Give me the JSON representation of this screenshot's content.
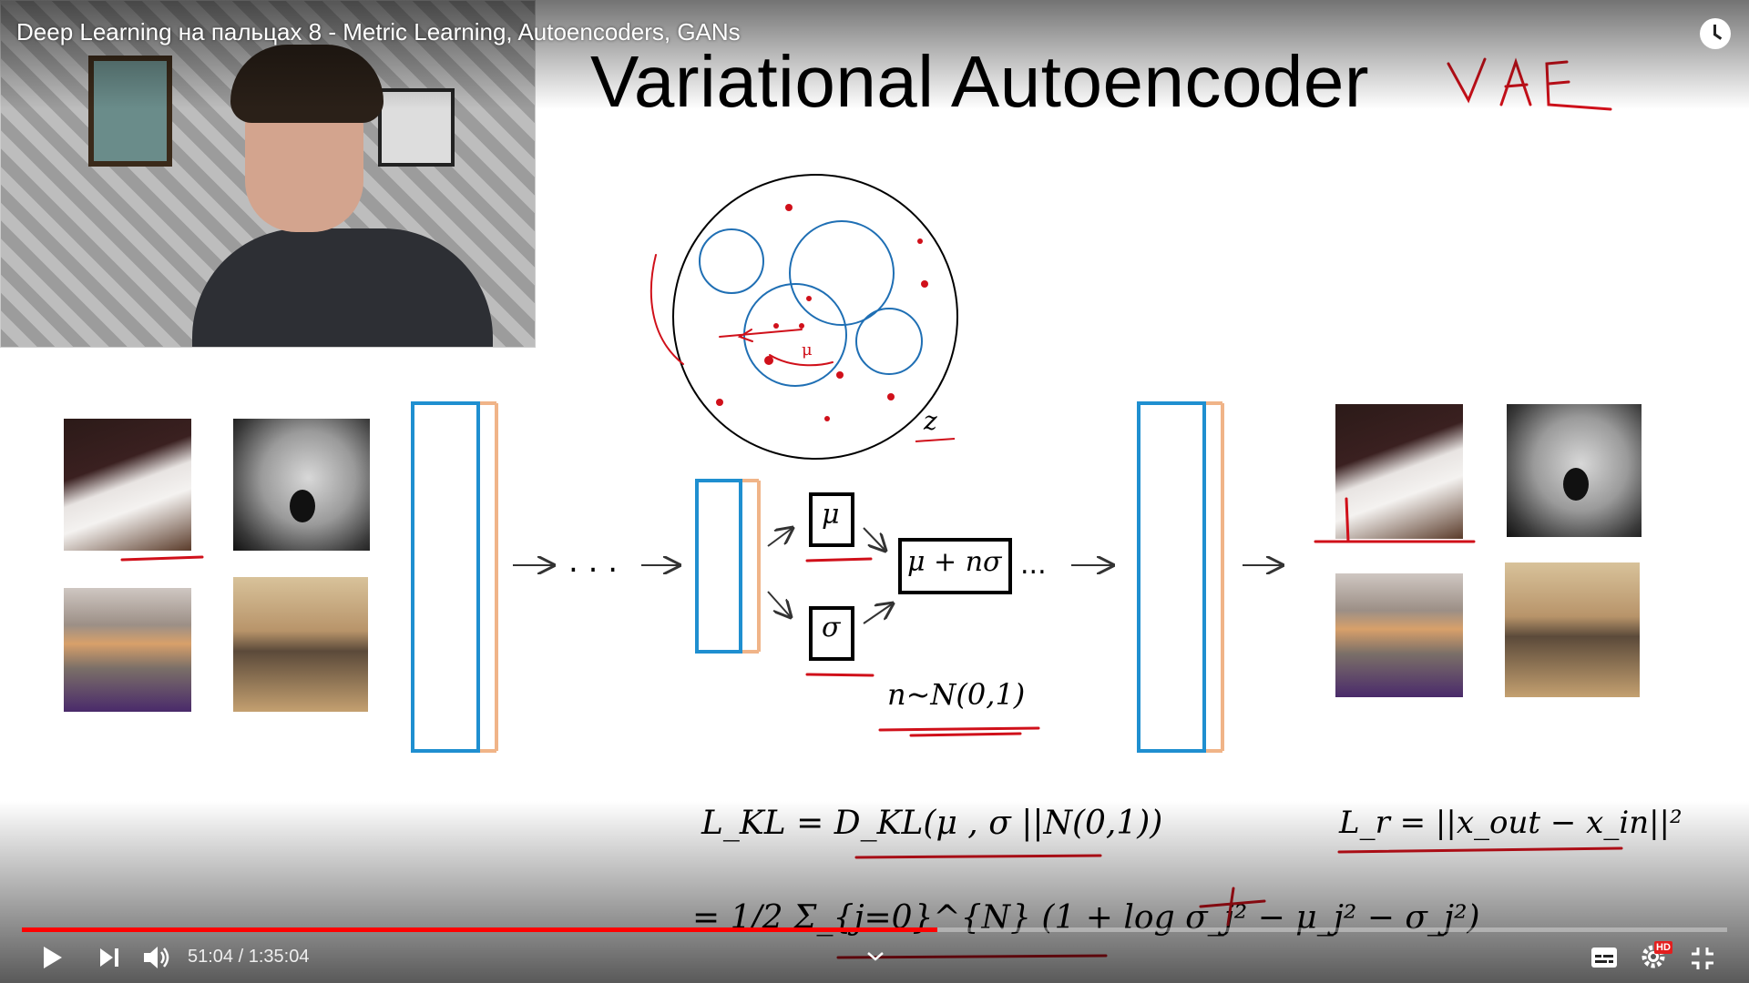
{
  "video": {
    "title": "Deep Learning на пальцах 8 - Metric Learning, Autoencoders, GANs"
  },
  "slide": {
    "title": "Variational Autoencoder",
    "annotation_vae": "VAE",
    "latent_label": "z",
    "mu_label": "μ",
    "sigma_label": "σ",
    "sample_label": "μ + nσ",
    "noise_eq": "n~N(0,1)",
    "dots": ". . .",
    "dots_after": "...",
    "loss_kl": "L_KL = D_KL(μ , σ ||N(0,1))",
    "loss_kl_expanded": "= 1/2 Σ_{j=0}^{N} (1 + log σ_j² − μ_j² − σ_j²)",
    "loss_r": "L_r = ||x_out − x_in||²"
  },
  "player": {
    "current_time": "51:04",
    "duration": "1:35:04",
    "time_display": "51:04 / 1:35:04",
    "progress_fraction": 0.537,
    "hd_badge": "HD",
    "accent_color": "#ff0000"
  },
  "icons": {
    "play": "play-icon",
    "next": "next-icon",
    "volume": "volume-icon",
    "subtitles": "subtitles-icon",
    "settings": "settings-icon",
    "fullscreen_exit": "fullscreen-exit-icon",
    "watch_later": "clock-icon",
    "chevron": "chevron-down-icon"
  }
}
